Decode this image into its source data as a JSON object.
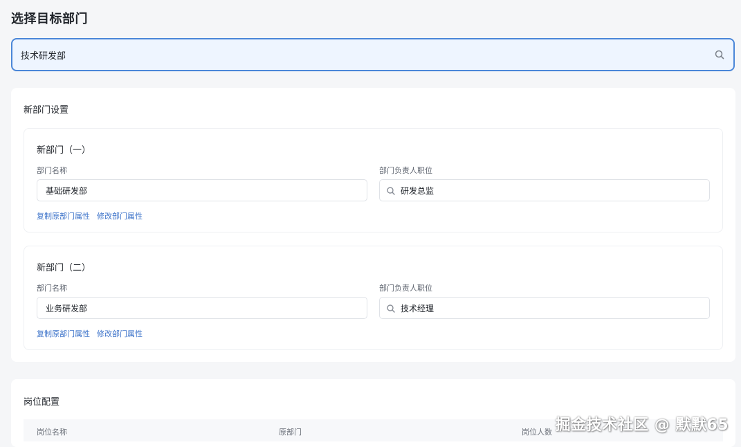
{
  "header": {
    "title": "选择目标部门"
  },
  "target_search": {
    "value": "技术研发部",
    "icon": "search-icon"
  },
  "new_dept_section": {
    "title": "新部门设置",
    "cards": [
      {
        "title": "新部门（一）",
        "name_label": "部门名称",
        "name_value": "基础研发部",
        "position_label": "部门负责人职位",
        "position_value": "研发总监",
        "copy_link": "复制原部门属性",
        "edit_link": "修改部门属性"
      },
      {
        "title": "新部门（二）",
        "name_label": "部门名称",
        "name_value": "业务研发部",
        "position_label": "部门负责人职位",
        "position_value": "技术经理",
        "copy_link": "复制原部门属性",
        "edit_link": "修改部门属性"
      }
    ]
  },
  "position_section": {
    "title": "岗位配置",
    "columns": [
      "岗位名称",
      "原部门",
      "岗位人数"
    ]
  },
  "watermark": "掘金技术社区 @ 默默65",
  "colors": {
    "accent": "#4a86d8",
    "link": "#3b72c9",
    "search_bg": "#eef5ff",
    "page_bg": "#f5f6f8"
  }
}
